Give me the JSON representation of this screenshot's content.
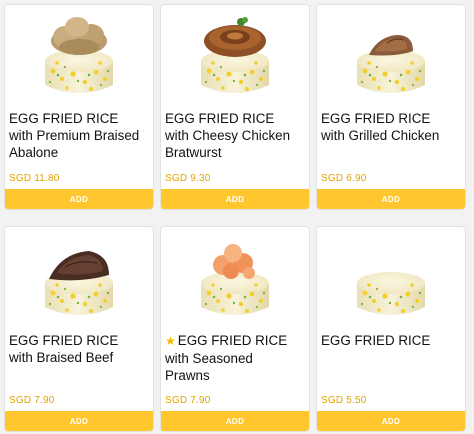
{
  "products": [
    {
      "name_lines": [
        "EGG FRIED RICE",
        "with Premium Braised",
        "Abalone"
      ],
      "price": "SGD 11.80",
      "add_label": "ADD",
      "featured": false,
      "topping": "abalone"
    },
    {
      "name_lines": [
        "EGG FRIED RICE",
        "with Cheesy Chicken",
        "Bratwurst"
      ],
      "price": "SGD 9.30",
      "add_label": "ADD",
      "featured": false,
      "topping": "bratwurst"
    },
    {
      "name_lines": [
        "EGG FRIED RICE",
        "with Grilled Chicken",
        ""
      ],
      "price": "SGD 6.90",
      "add_label": "ADD",
      "featured": false,
      "topping": "grilled-chicken"
    },
    {
      "name_lines": [
        "EGG FRIED RICE",
        "with Braised Beef",
        ""
      ],
      "price": "SGD 7.90",
      "add_label": "ADD",
      "featured": false,
      "topping": "braised-beef"
    },
    {
      "name_lines": [
        "EGG FRIED RICE",
        "with Seasoned",
        "Prawns"
      ],
      "price": "SGD 7.90",
      "add_label": "ADD",
      "featured": true,
      "topping": "prawns"
    },
    {
      "name_lines": [
        "EGG FRIED RICE",
        "",
        ""
      ],
      "price": "SGD 5.50",
      "add_label": "ADD",
      "featured": false,
      "topping": "none"
    }
  ],
  "colors": {
    "accent": "#ffc62e",
    "price": "#e0a400",
    "star": "#f5b800"
  },
  "icons": {
    "featured": "star-icon"
  }
}
